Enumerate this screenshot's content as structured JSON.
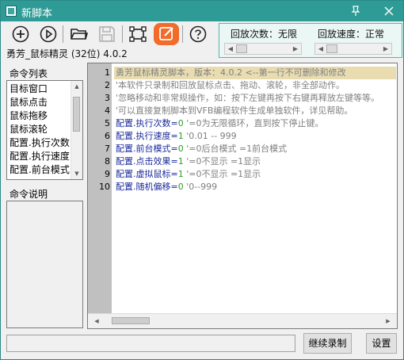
{
  "window": {
    "title": "新脚本"
  },
  "app_title": "勇芳_鼠标精灵 (32位) 4.0.2",
  "panel": {
    "loop_label": "回放次数：无限",
    "speed_label": "回放速度：正常"
  },
  "left": {
    "list_header": "命令列表",
    "desc_header": "命令说明",
    "items": [
      "目标窗口",
      "鼠标点击",
      "鼠标拖移",
      "鼠标滚轮",
      "配置.执行次数",
      "配置.执行速度",
      "配置.前台模式"
    ]
  },
  "editor": {
    "line_numbers": [
      "1",
      "2",
      "3",
      "4",
      "5",
      "6",
      "7",
      "8",
      "9",
      "10"
    ],
    "line1": "勇芳鼠标精灵脚本，版本：4.0.2  <--第一行不可删除和修改",
    "line2": "'本软件只录制和回放鼠标点击、拖动、滚轮，非全部动作。",
    "line3": "'忽略移动和非常规操作，如：按下左键再按下右键再释放左键等等。",
    "line4": "'可以直接复制脚本到VFB编程软件生成单独软件，详见帮助。",
    "line5": {
      "k": "配置.执行次数",
      "e": "=",
      "v": "0",
      "c": " '=0为无限循环，直到按下停止键。"
    },
    "line6": {
      "k": "配置.执行速度",
      "e": "=",
      "v": "1",
      "c": " '0.01 -- 999"
    },
    "line7": {
      "k": "配置.前台模式",
      "e": "=",
      "v": "0",
      "c": " '=0后台模式 =1前台模式"
    },
    "line8": {
      "k": "配置.点击效果",
      "e": "=",
      "v": "1",
      "c": " '=0不显示 =1显示"
    },
    "line9": {
      "k": "配置.虚拟鼠标",
      "e": "=",
      "v": "1",
      "c": " '=0不显示 =1显示"
    },
    "line10": {
      "k": "配置.随机偏移",
      "e": "=",
      "v": "0",
      "c": " '0--999"
    }
  },
  "buttons": {
    "continue_record": "继续录制",
    "settings": "设置"
  },
  "colors": {
    "titlebar": "#2f9b96",
    "edit_accent": "#f36b2a",
    "keyword": "#1a2a9a",
    "number": "#2aa02a",
    "highlight": "#e8dcb0"
  }
}
